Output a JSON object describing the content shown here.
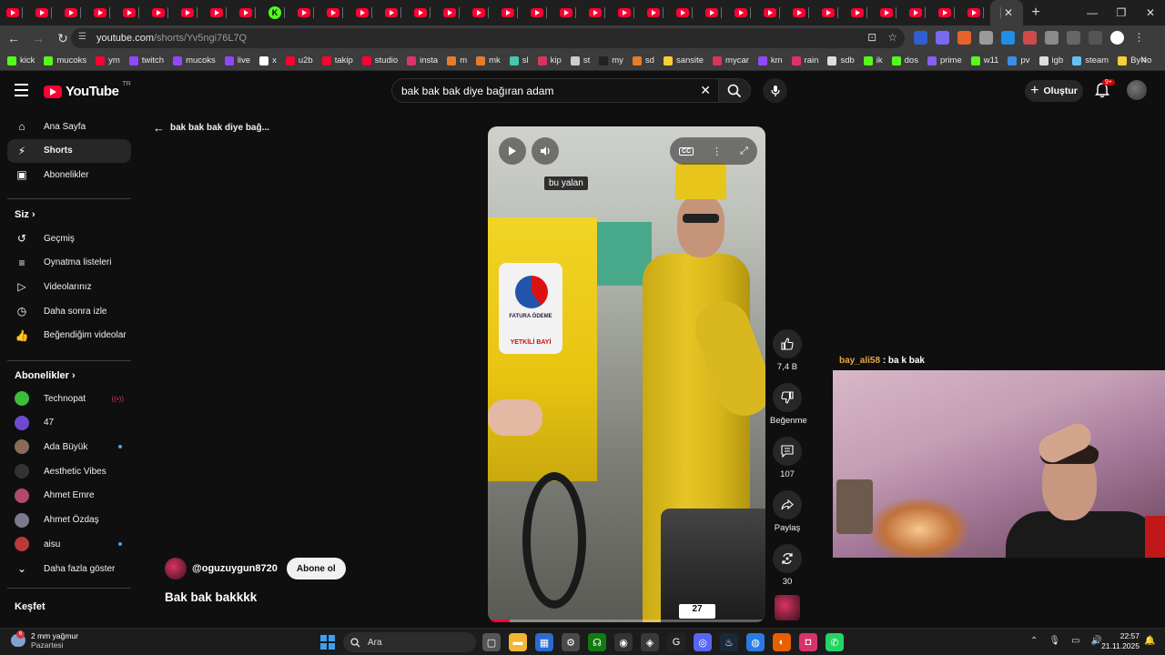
{
  "browser": {
    "tab_count_visible": 34,
    "url_host": "youtube.com",
    "url_path": "/shorts/Yv5ngi76L7Q",
    "bookmarks": [
      {
        "label": "kick",
        "color": "#53fc18"
      },
      {
        "label": "mucoks",
        "color": "#53fc18"
      },
      {
        "label": "ym",
        "color": "#ff0033"
      },
      {
        "label": "twitch",
        "color": "#9146ff"
      },
      {
        "label": "mucoks",
        "color": "#9146ff"
      },
      {
        "label": "live",
        "color": "#9146ff"
      },
      {
        "label": "x",
        "color": "#ffffff"
      },
      {
        "label": "u2b",
        "color": "#ff0033"
      },
      {
        "label": "takip",
        "color": "#ff0033"
      },
      {
        "label": "studio",
        "color": "#ff0033"
      },
      {
        "label": "insta",
        "color": "#e1306c"
      },
      {
        "label": "m",
        "color": "#e87a2b"
      },
      {
        "label": "mk",
        "color": "#e87a2b"
      },
      {
        "label": "sl",
        "color": "#49c5b6"
      },
      {
        "label": "kip",
        "color": "#d8345f"
      },
      {
        "label": "st",
        "color": "#cccccc"
      },
      {
        "label": "my",
        "color": "#222222"
      },
      {
        "label": "sd",
        "color": "#e87a2b"
      },
      {
        "label": "sansite",
        "color": "#f7d033"
      },
      {
        "label": "mycar",
        "color": "#d8345f"
      },
      {
        "label": "km",
        "color": "#9146ff"
      },
      {
        "label": "rain",
        "color": "#e1306c"
      },
      {
        "label": "sdb",
        "color": "#dddddd"
      },
      {
        "label": "ik",
        "color": "#53fc18"
      },
      {
        "label": "dos",
        "color": "#53fc18"
      },
      {
        "label": "prime",
        "color": "#8b5cf6"
      },
      {
        "label": "w11",
        "color": "#53fc18"
      },
      {
        "label": "pv",
        "color": "#3a8ee6"
      },
      {
        "label": "igb",
        "color": "#dddddd"
      },
      {
        "label": "steam",
        "color": "#66c0f4"
      },
      {
        "label": "ByNo",
        "color": "#f7d033"
      }
    ]
  },
  "youtube": {
    "logo": "YouTube",
    "country": "TR",
    "search_query": "bak bak bak diye bağıran adam",
    "create_label": "Oluştur",
    "notifications_badge": "9+",
    "sidebar": {
      "top": [
        {
          "label": "Ana Sayfa",
          "icon": "home-icon",
          "glyph": "⌂"
        },
        {
          "label": "Shorts",
          "icon": "shorts-icon",
          "glyph": "⚡"
        },
        {
          "label": "Abonelikler",
          "icon": "subscriptions-icon",
          "glyph": "▣"
        }
      ],
      "you_heading": "Siz",
      "you": [
        {
          "label": "Geçmiş",
          "icon": "history-icon",
          "glyph": "↺"
        },
        {
          "label": "Oynatma listeleri",
          "icon": "playlists-icon",
          "glyph": "≡"
        },
        {
          "label": "Videolarınız",
          "icon": "your-videos-icon",
          "glyph": "▷"
        },
        {
          "label": "Daha sonra izle",
          "icon": "watch-later-icon",
          "glyph": "◷"
        },
        {
          "label": "Beğendiğim videolar",
          "icon": "liked-videos-icon",
          "glyph": "👍"
        }
      ],
      "subs_heading": "Abonelikler",
      "subs": [
        {
          "label": "Technopat",
          "color": "#3bbd3b",
          "marker": "live"
        },
        {
          "label": "47",
          "color": "#6c4bd1",
          "marker": ""
        },
        {
          "label": "Ada Büyük",
          "color": "#8a6a5a",
          "marker": "dot"
        },
        {
          "label": "Aesthetic Vibes",
          "color": "#333333",
          "marker": ""
        },
        {
          "label": "Ahmet Emre",
          "color": "#b04a6a",
          "marker": ""
        },
        {
          "label": "Ahmet Özdaş",
          "color": "#7a7a8a",
          "marker": ""
        },
        {
          "label": "aisu",
          "color": "#b83a3a",
          "marker": "dot"
        }
      ],
      "show_more": "Daha fazla göster",
      "explore_heading": "Keşfet"
    },
    "short": {
      "back_title": "bak bak bak diye bağ...",
      "caption": "bu yalan",
      "sign_top": "FATURA ÖDEME",
      "sign_bottom": "YETKİLİ BAYİ",
      "plate": "27",
      "progress": 0.08,
      "channel": "@oguzuygun8720",
      "subscribe_label": "Abone ol",
      "title": "Bak bak bakkkk",
      "likes": "7,4 B",
      "dislike_label": "Beğenme",
      "comments": "107",
      "share_label": "Paylaş",
      "remix_count": "30"
    }
  },
  "overlay": {
    "chat_user": "bay_ali58",
    "chat_message": " : ba k bak"
  },
  "taskbar": {
    "weather_badge": "6",
    "weather_temp": "2 mm yağmur",
    "weather_day": "Pazartesi",
    "search_placeholder": "Ara",
    "time": "22:57",
    "date": "21.11.2025",
    "pinned_apps": [
      {
        "name": "task-view-icon",
        "color": "#555555",
        "glyph": "▢"
      },
      {
        "name": "file-explorer-icon",
        "color": "#f2b632",
        "glyph": "▬"
      },
      {
        "name": "ms-store-icon",
        "color": "#2a6ad1",
        "glyph": "▦"
      },
      {
        "name": "settings-icon",
        "color": "#4a4a4a",
        "glyph": "⚙"
      },
      {
        "name": "xbox-icon",
        "color": "#107c10",
        "glyph": "☊"
      },
      {
        "name": "github-icon",
        "color": "#333333",
        "glyph": "◉"
      },
      {
        "name": "app-icon",
        "color": "#3a3a3a",
        "glyph": "◈"
      },
      {
        "name": "app2-icon",
        "color": "#222222",
        "glyph": "G"
      },
      {
        "name": "discord-icon",
        "color": "#5865f2",
        "glyph": "◎"
      },
      {
        "name": "steam-icon",
        "color": "#1b2838",
        "glyph": "♨"
      },
      {
        "name": "chrome-icon",
        "color": "#2a7ae2",
        "glyph": "◍"
      },
      {
        "name": "firefox-icon",
        "color": "#e66000",
        "glyph": "◐"
      },
      {
        "name": "instagram-icon",
        "color": "#d6336c",
        "glyph": "◘"
      },
      {
        "name": "whatsapp-icon",
        "color": "#25d366",
        "glyph": "✆"
      }
    ]
  }
}
